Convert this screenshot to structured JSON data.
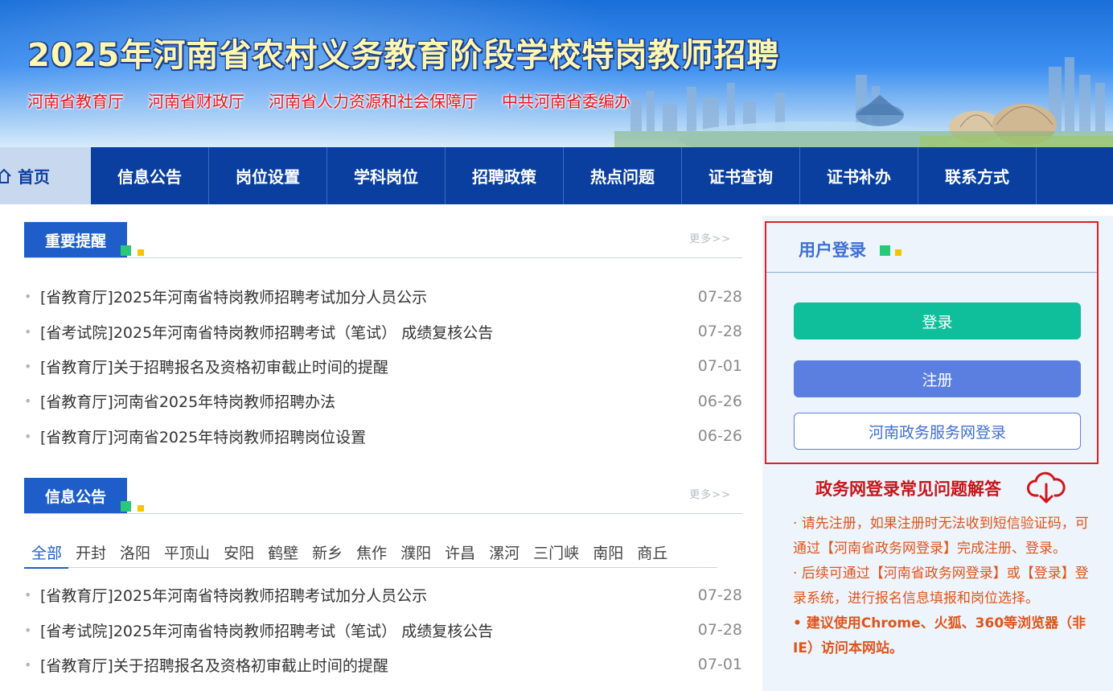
{
  "banner": {
    "title": "2025年河南省农村义务教育阶段学校特岗教师招聘",
    "orgs": [
      "河南省教育厅",
      "河南省财政厅",
      "河南省人力资源和社会保障厅",
      "中共河南省委编办"
    ]
  },
  "nav": {
    "home": "首页",
    "items": [
      "信息公告",
      "岗位设置",
      "学科岗位",
      "招聘政策",
      "热点问题",
      "证书查询",
      "证书补办",
      "联系方式"
    ]
  },
  "important": {
    "heading": "重要提醒",
    "more": "更多>>",
    "items": [
      {
        "title": "[省教育厅]2025年河南省特岗教师招聘考试加分人员公示",
        "date": "07-28"
      },
      {
        "title": "[省考试院]2025年河南省特岗教师招聘考试（笔试） 成绩复核公告",
        "date": "07-28"
      },
      {
        "title": "[省教育厅]关于招聘报名及资格初审截止时间的提醒",
        "date": "07-01"
      },
      {
        "title": "[省教育厅]河南省2025年特岗教师招聘办法",
        "date": "06-26"
      },
      {
        "title": "[省教育厅]河南省2025年特岗教师招聘岗位设置",
        "date": "06-26"
      }
    ]
  },
  "notices": {
    "heading": "信息公告",
    "more": "更多>>",
    "cities": [
      "全部",
      "开封",
      "洛阳",
      "平顶山",
      "安阳",
      "鹤壁",
      "新乡",
      "焦作",
      "濮阳",
      "许昌",
      "漯河",
      "三门峡",
      "南阳",
      "商丘"
    ],
    "active_city": "全部",
    "items": [
      {
        "title": "[省教育厅]2025年河南省特岗教师招聘考试加分人员公示",
        "date": "07-28"
      },
      {
        "title": "[省考试院]2025年河南省特岗教师招聘考试（笔试） 成绩复核公告",
        "date": "07-28"
      },
      {
        "title": "[省教育厅]关于招聘报名及资格初审截止时间的提醒",
        "date": "07-01"
      }
    ]
  },
  "login": {
    "heading": "用户登录",
    "login_btn": "登录",
    "register_btn": "注册",
    "gov_btn": "河南政务服务网登录"
  },
  "faq": {
    "title": "政务网登录常见问题解答",
    "p1": "· 请先注册，如果注册时无法收到短信验证码，可通过【河南省政务网登录】完成注册、登录。",
    "p2": "· 后续可通过【河南省政务网登录】或【登录】登录系统，进行报名信息填报和岗位选择。",
    "p3": "• 建议使用Chrome、火狐、360等浏览器（非IE）访问本网站。"
  },
  "colors": {
    "nav_bg": "#0a3fa0",
    "accent_blue": "#1f5ec9",
    "login_green": "#0fbf9c",
    "register_blue": "#5b7fe0",
    "faq_red": "#c8141a",
    "faq_orange": "#e0541a"
  }
}
